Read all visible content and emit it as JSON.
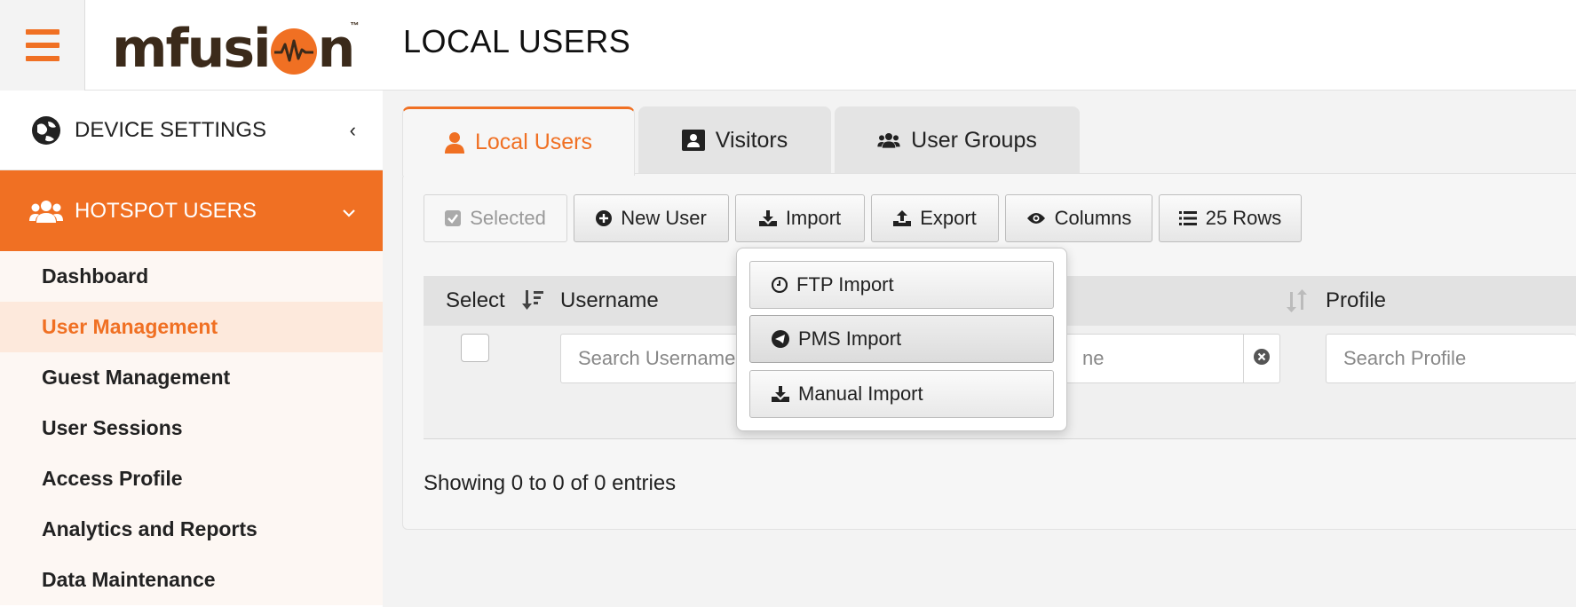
{
  "header": {
    "logo_text_left": "mfusi",
    "logo_text_right": "n",
    "logo_tm": "™",
    "page_title": "LOCAL USERS"
  },
  "sidebar": {
    "device_settings": "DEVICE SETTINGS",
    "hotspot_users": "HOTSPOT USERS",
    "items": [
      {
        "label": "Dashboard",
        "active": false
      },
      {
        "label": "User Management",
        "active": true
      },
      {
        "label": "Guest Management",
        "active": false
      },
      {
        "label": "User Sessions",
        "active": false
      },
      {
        "label": "Access Profile",
        "active": false
      },
      {
        "label": "Analytics and Reports",
        "active": false
      },
      {
        "label": "Data Maintenance",
        "active": false
      }
    ]
  },
  "tabs": {
    "local_users": "Local Users",
    "visitors": "Visitors",
    "user_groups": "User Groups"
  },
  "toolbar": {
    "selected": "Selected",
    "new_user": "New User",
    "import": "Import",
    "export": "Export",
    "columns": "Columns",
    "rows": "25 Rows"
  },
  "import_menu": {
    "ftp": "FTP Import",
    "pms": "PMS Import",
    "manual": "Manual Import"
  },
  "table": {
    "col_select": "Select",
    "col_username": "Username",
    "col_profile": "Profile",
    "search_username_placeholder": "Search Username",
    "search_hidden_partial": "ne",
    "search_profile_placeholder": "Search Profile",
    "showing": "Showing 0 to 0 of 0 entries"
  },
  "colors": {
    "accent": "#f07023",
    "logo_dark": "#3b2a1a"
  }
}
